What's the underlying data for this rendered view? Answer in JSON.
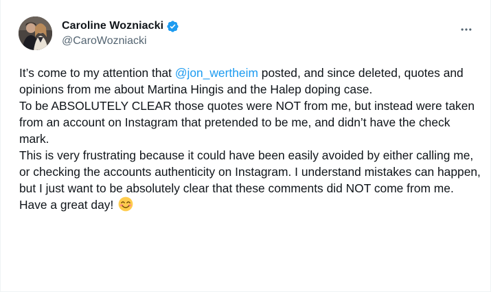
{
  "author": {
    "display_name": "Caroline Wozniacki",
    "handle": "@CaroWozniacki",
    "verified": true,
    "verified_color": "#1d9bf0"
  },
  "icons": {
    "verified": "verified-badge-icon",
    "more": "more-horizontal-icon",
    "emoji": "smiling-face-with-smiling-eyes-emoji"
  },
  "tweet": {
    "p1_before": "It’s come to my attention that ",
    "p1_mention": "@jon_wertheim",
    "p1_after": " posted, and since deleted, quotes and opinions from me about Martina Hingis and  the Halep doping case.",
    "p2": "To be ABSOLUTELY CLEAR those quotes were NOT from me, but instead were taken from an account on Instagram that pretended to be me, and didn’t have the check mark.",
    "p3": "This is very frustrating because it could have been easily avoided by either calling me, or checking the accounts authenticity on Instagram. I understand mistakes can happen, but I just want to be absolutely clear that these comments did NOT come from me.",
    "p4": "Have a great day! "
  },
  "colors": {
    "text": "#0f1419",
    "secondary": "#536471",
    "accent": "#1d9bf0"
  }
}
